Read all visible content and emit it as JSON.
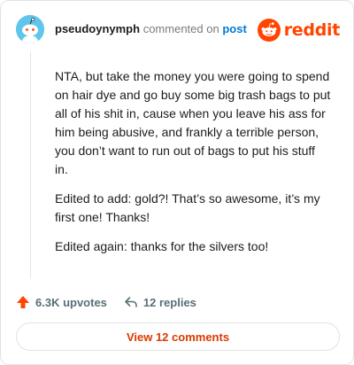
{
  "header": {
    "username": "pseudoynymph",
    "action_text": "commented on",
    "post_label": "post",
    "brand": "reddit",
    "avatar_icon": "snoo-avatar-icon",
    "logo_icon": "reddit-alien-icon"
  },
  "comment": {
    "paragraphs": [
      "NTA, but take the money you were going to spend on hair dye and go buy some big trash bags to put all of his shit in, cause when you leave his ass for him being abusive, and frankly a terrible person, you don’t want to run out of bags to put his stuff in.",
      "Edited to add: gold?! That’s so awesome, it’s my first one! Thanks!",
      "Edited again: thanks for the silvers too!"
    ]
  },
  "actions": {
    "upvotes": "6.3K upvotes",
    "replies": "12 replies",
    "upvote_icon": "upvote-arrow-icon",
    "reply_icon": "reply-arrow-icon"
  },
  "footer": {
    "view_comments": "View 12 comments"
  },
  "colors": {
    "brand_orange": "#ff4500",
    "link_blue": "#0079d3",
    "view_button_text": "#d93a00",
    "avatar_bg": "#5fc5ea"
  }
}
